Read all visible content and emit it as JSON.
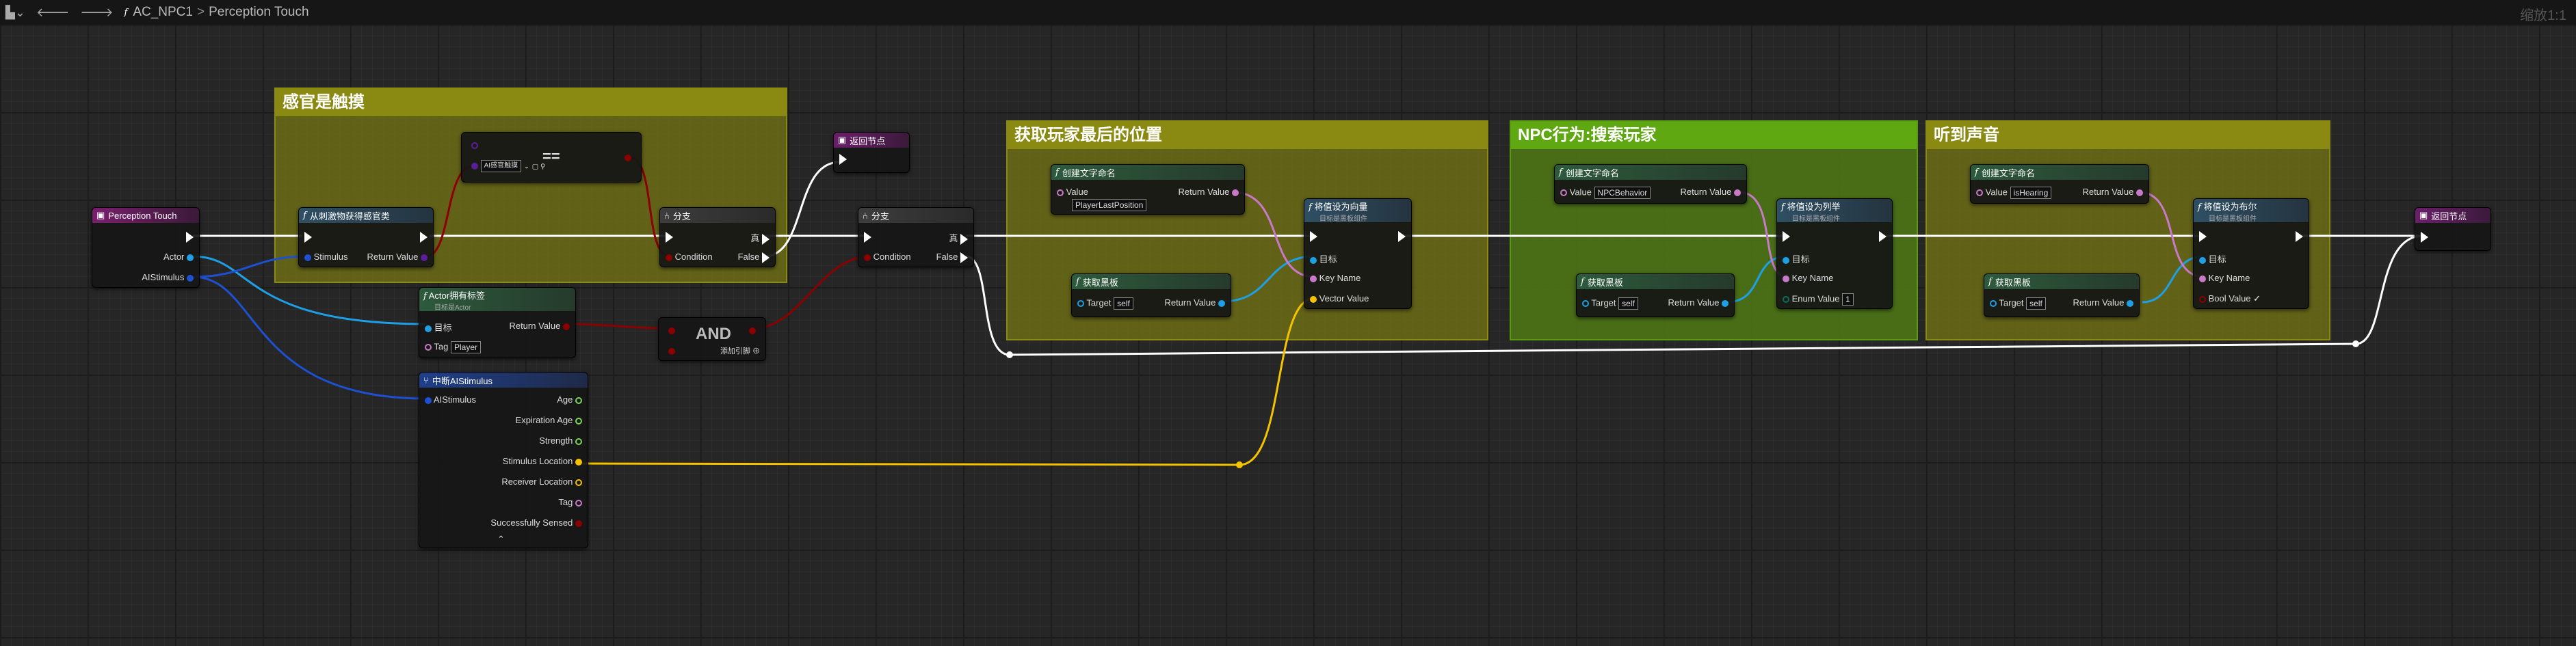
{
  "topbar": {
    "menu_icon": "blueprint-menu-icon",
    "func_icon": "f",
    "blueprint": "AC_NPC1",
    "separator": ">",
    "function": "Perception Touch",
    "zoom": "缩放1:1"
  },
  "comments": {
    "touch": "感官是触摸",
    "last_pos": "获取玩家最后的位置",
    "behavior": "NPC行为:搜索玩家",
    "hearing": "听到声音"
  },
  "nodes": {
    "entry": {
      "title": "Perception Touch",
      "actor": "Actor",
      "stimulus": "AIStimulus"
    },
    "get_sense": {
      "title": "从刺激物获得感官类",
      "stimulus": "Stimulus",
      "ret": "Return Value"
    },
    "equal": {
      "op": "==",
      "dropdown": "AI感官触摸"
    },
    "branch1": {
      "title": "分支",
      "condition": "Condition",
      "true": "真",
      "false": "False"
    },
    "return1": {
      "title": "返回节点"
    },
    "branch2": {
      "title": "分支",
      "condition": "Condition",
      "true": "真",
      "false": "False"
    },
    "has_tag": {
      "title": "Actor拥有标签",
      "sub": "目标是Actor",
      "target": "目标",
      "ret": "Return Value",
      "tag": "Tag",
      "tag_value": "Player"
    },
    "and": {
      "title": "AND",
      "add": "添加引脚"
    },
    "break": {
      "title": "中断AIStimulus",
      "in": "AIStimulus",
      "outs": [
        "Age",
        "Expiration Age",
        "Strength",
        "Stimulus Location",
        "Receiver Location",
        "Tag",
        "Successfully Sensed"
      ]
    },
    "make_name1": {
      "title": "创建文字命名",
      "value": "Value",
      "value_text": "PlayerLastPosition",
      "ret": "Return Value"
    },
    "get_bb1": {
      "title": "获取黑板",
      "target": "Target",
      "target_value": "self",
      "ret": "Return Value"
    },
    "set_vec": {
      "title": "将值设为向量",
      "sub": "目标是黑板组件",
      "target": "目标",
      "key": "Key Name",
      "val": "Vector Value"
    },
    "make_name2": {
      "title": "创建文字命名",
      "value": "Value",
      "value_text": "NPCBehavior",
      "ret": "Return Value"
    },
    "get_bb2": {
      "title": "获取黑板",
      "target": "Target",
      "target_value": "self",
      "ret": "Return Value"
    },
    "set_enum": {
      "title": "将值设为列举",
      "sub": "目标是黑板组件",
      "target": "目标",
      "key": "Key Name",
      "val": "Enum Value",
      "val_value": "1"
    },
    "make_name3": {
      "title": "创建文字命名",
      "value": "Value",
      "value_text": "isHearing",
      "ret": "Return Value"
    },
    "get_bb3": {
      "title": "获取黑板",
      "target": "Target",
      "target_value": "self",
      "ret": "Return Value"
    },
    "set_bool": {
      "title": "将值设为布尔",
      "sub": "目标是黑板组件",
      "target": "目标",
      "key": "Key Name",
      "val": "Bool Value",
      "check": "✓"
    },
    "return2": {
      "title": "返回节点"
    }
  },
  "colors": {
    "exec": "#ffffff",
    "object": "#1ea0e6",
    "struct": "#1e50d2",
    "bool": "#8c0000",
    "name": "#c879c8",
    "vector": "#f5c200",
    "float": "#7ad65c",
    "byte": "#0a6e5a",
    "comment_yellow": "#6f6f16",
    "comment_green": "#4f7a14"
  }
}
